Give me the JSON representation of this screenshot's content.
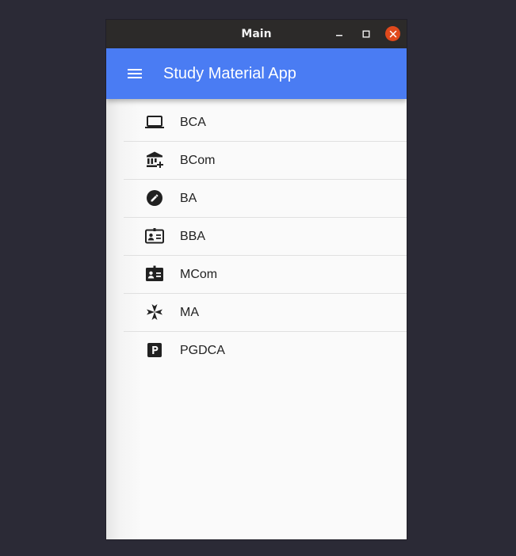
{
  "window": {
    "title": "Main"
  },
  "appbar": {
    "title": "Study Material App",
    "color": "#4a7cf3"
  },
  "courses": [
    {
      "label": "BCA",
      "icon": "laptop-icon"
    },
    {
      "label": "BCom",
      "icon": "account-balance-icon"
    },
    {
      "label": "BA",
      "icon": "edit-pencil-icon"
    },
    {
      "label": "BBA",
      "icon": "badge-icon"
    },
    {
      "label": "MCom",
      "icon": "contact-card-icon"
    },
    {
      "label": "MA",
      "icon": "maltese-cross-icon"
    },
    {
      "label": "PGDCA",
      "icon": "local-parking-icon"
    }
  ]
}
